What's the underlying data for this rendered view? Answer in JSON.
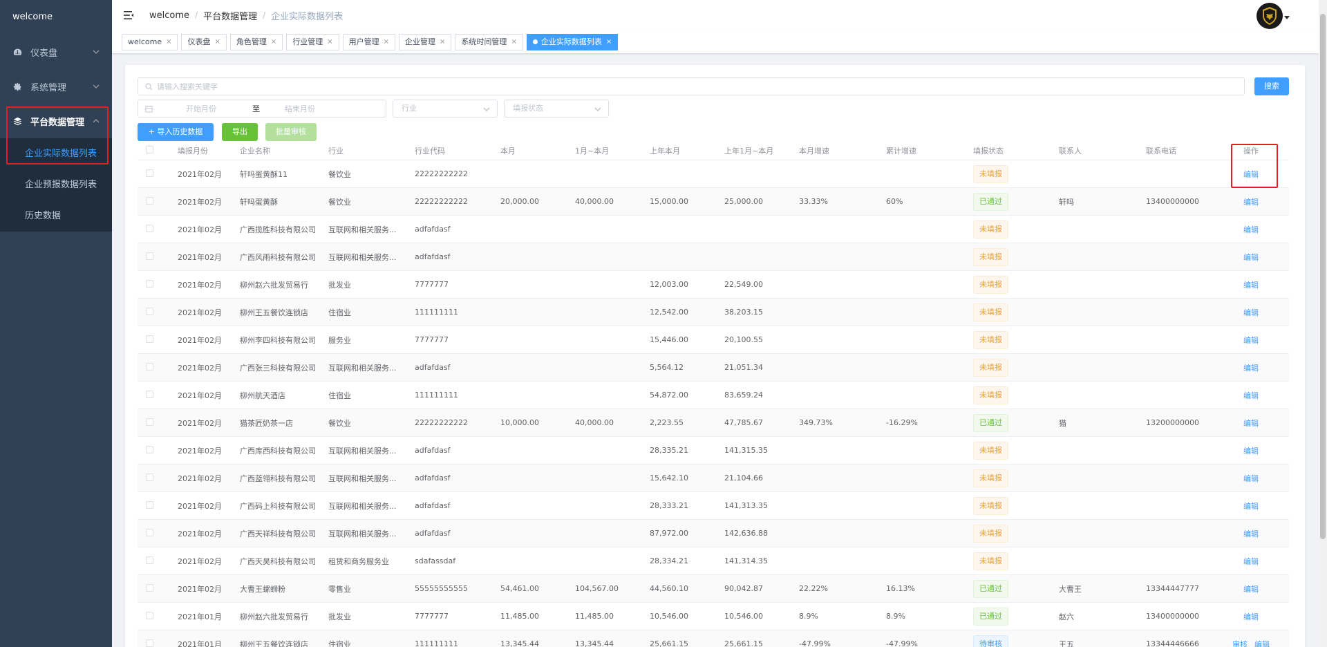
{
  "sidebar": {
    "brand": "welcome",
    "menu": [
      {
        "label": "仪表盘",
        "icon": "dashboard-icon"
      },
      {
        "label": "系统管理",
        "icon": "gear-icon"
      },
      {
        "label": "平台数据管理",
        "icon": "layers-icon"
      }
    ],
    "submenu": [
      "企业实际数据列表",
      "企业预报数据列表",
      "历史数据"
    ]
  },
  "breadcrumb": [
    "welcome",
    "平台数据管理",
    "企业实际数据列表"
  ],
  "tags": [
    "welcome",
    "仪表盘",
    "角色管理",
    "行业管理",
    "用户管理",
    "企业管理",
    "系统时间管理",
    "企业实际数据列表"
  ],
  "filters": {
    "search_placeholder": "请输入搜索关键字",
    "search_button": "搜索",
    "start_month": "开始月份",
    "range_to": "至",
    "end_month": "结束月份",
    "industry_placeholder": "行业",
    "status_placeholder": "填报状态"
  },
  "actions": {
    "import": "导入历史数据",
    "export": "导出",
    "batch": "批量审核"
  },
  "table": {
    "headers": [
      "",
      "填报月份",
      "企业名称",
      "行业",
      "行业代码",
      "本月",
      "1月~本月",
      "上年本月",
      "上年1月~本月",
      "本月增速",
      "累计增速",
      "填报状态",
      "联系人",
      "联系电话",
      "操作"
    ],
    "edit_label": "编辑",
    "review_label": "审核",
    "rows": [
      {
        "month": "2021年02月",
        "company": "轩吗蛋黄酥11",
        "industry": "餐饮业",
        "code": "22222222222",
        "cur": "",
        "ytd": "",
        "ly_cur": "",
        "ly_ytd": "",
        "growth": "",
        "cum_growth": "",
        "status": "未填报",
        "status_type": "unfilled",
        "contact": "",
        "phone": ""
      },
      {
        "month": "2021年02月",
        "company": "轩吗蛋黄酥",
        "industry": "餐饮业",
        "code": "22222222222",
        "cur": "20,000.00",
        "ytd": "40,000.00",
        "ly_cur": "15,000.00",
        "ly_ytd": "25,000.00",
        "growth": "33.33%",
        "cum_growth": "60%",
        "status": "已通过",
        "status_type": "passed",
        "contact": "轩吗",
        "phone": "13400000000"
      },
      {
        "month": "2021年02月",
        "company": "广西揽胜科技有限公司",
        "industry": "互联网和相关服务...",
        "code": "adfafdasf",
        "cur": "",
        "ytd": "",
        "ly_cur": "",
        "ly_ytd": "",
        "growth": "",
        "cum_growth": "",
        "status": "未填报",
        "status_type": "unfilled",
        "contact": "",
        "phone": ""
      },
      {
        "month": "2021年02月",
        "company": "广西风雨科技有限公司",
        "industry": "互联网和相关服务...",
        "code": "adfafdasf",
        "cur": "",
        "ytd": "",
        "ly_cur": "",
        "ly_ytd": "",
        "growth": "",
        "cum_growth": "",
        "status": "未填报",
        "status_type": "unfilled",
        "contact": "",
        "phone": ""
      },
      {
        "month": "2021年02月",
        "company": "柳州赵六批发贸易行",
        "industry": "批发业",
        "code": "7777777",
        "cur": "",
        "ytd": "",
        "ly_cur": "12,003.00",
        "ly_ytd": "22,549.00",
        "growth": "",
        "cum_growth": "",
        "status": "未填报",
        "status_type": "unfilled",
        "contact": "",
        "phone": ""
      },
      {
        "month": "2021年02月",
        "company": "柳州王五餐饮连锁店",
        "industry": "住宿业",
        "code": "111111111",
        "cur": "",
        "ytd": "",
        "ly_cur": "12,542.00",
        "ly_ytd": "38,203.15",
        "growth": "",
        "cum_growth": "",
        "status": "未填报",
        "status_type": "unfilled",
        "contact": "",
        "phone": ""
      },
      {
        "month": "2021年02月",
        "company": "柳州李四科技有限公司",
        "industry": "服务业",
        "code": "7777777",
        "cur": "",
        "ytd": "",
        "ly_cur": "15,446.00",
        "ly_ytd": "20,100.55",
        "growth": "",
        "cum_growth": "",
        "status": "未填报",
        "status_type": "unfilled",
        "contact": "",
        "phone": ""
      },
      {
        "month": "2021年02月",
        "company": "广西张三科技有限公司",
        "industry": "互联网和相关服务...",
        "code": "adfafdasf",
        "cur": "",
        "ytd": "",
        "ly_cur": "5,564.12",
        "ly_ytd": "21,051.34",
        "growth": "",
        "cum_growth": "",
        "status": "未填报",
        "status_type": "unfilled",
        "contact": "",
        "phone": ""
      },
      {
        "month": "2021年02月",
        "company": "柳州航天酒店",
        "industry": "住宿业",
        "code": "111111111",
        "cur": "",
        "ytd": "",
        "ly_cur": "54,872.00",
        "ly_ytd": "83,659.24",
        "growth": "",
        "cum_growth": "",
        "status": "未填报",
        "status_type": "unfilled",
        "contact": "",
        "phone": ""
      },
      {
        "month": "2021年02月",
        "company": "猫茶匠奶茶一店",
        "industry": "餐饮业",
        "code": "22222222222",
        "cur": "10,000.00",
        "ytd": "40,000.00",
        "ly_cur": "2,223.55",
        "ly_ytd": "47,785.67",
        "growth": "349.73%",
        "cum_growth": "-16.29%",
        "status": "已通过",
        "status_type": "passed",
        "contact": "猫",
        "phone": "13200000000"
      },
      {
        "month": "2021年02月",
        "company": "广西库西科技有限公司",
        "industry": "互联网和相关服务...",
        "code": "adfafdasf",
        "cur": "",
        "ytd": "",
        "ly_cur": "28,335.21",
        "ly_ytd": "141,315.35",
        "growth": "",
        "cum_growth": "",
        "status": "未填报",
        "status_type": "unfilled",
        "contact": "",
        "phone": ""
      },
      {
        "month": "2021年02月",
        "company": "广西蓝翎科技有限公司",
        "industry": "互联网和相关服务...",
        "code": "adfafdasf",
        "cur": "",
        "ytd": "",
        "ly_cur": "15,642.10",
        "ly_ytd": "21,104.66",
        "growth": "",
        "cum_growth": "",
        "status": "未填报",
        "status_type": "unfilled",
        "contact": "",
        "phone": ""
      },
      {
        "month": "2021年02月",
        "company": "广西码上科技有限公司",
        "industry": "互联网和相关服务...",
        "code": "adfafdasf",
        "cur": "",
        "ytd": "",
        "ly_cur": "28,333.21",
        "ly_ytd": "141,313.35",
        "growth": "",
        "cum_growth": "",
        "status": "未填报",
        "status_type": "unfilled",
        "contact": "",
        "phone": ""
      },
      {
        "month": "2021年02月",
        "company": "广西天祥科技有限公司",
        "industry": "互联网和相关服务...",
        "code": "adfafdasf",
        "cur": "",
        "ytd": "",
        "ly_cur": "87,972.00",
        "ly_ytd": "142,636.88",
        "growth": "",
        "cum_growth": "",
        "status": "未填报",
        "status_type": "unfilled",
        "contact": "",
        "phone": ""
      },
      {
        "month": "2021年02月",
        "company": "广西天昊科技有限公司",
        "industry": "租赁和商务服务业",
        "code": "sdafassdaf",
        "cur": "",
        "ytd": "",
        "ly_cur": "28,334.21",
        "ly_ytd": "141,314.35",
        "growth": "",
        "cum_growth": "",
        "status": "未填报",
        "status_type": "unfilled",
        "contact": "",
        "phone": ""
      },
      {
        "month": "2021年02月",
        "company": "大曹王螺蛳粉",
        "industry": "零售业",
        "code": "55555555555",
        "cur": "54,461.00",
        "ytd": "104,567.00",
        "ly_cur": "44,560.10",
        "ly_ytd": "90,042.87",
        "growth": "22.22%",
        "cum_growth": "16.13%",
        "status": "已通过",
        "status_type": "passed",
        "contact": "大曹王",
        "phone": "13344447777"
      },
      {
        "month": "2021年01月",
        "company": "柳州赵六批发贸易行",
        "industry": "批发业",
        "code": "7777777",
        "cur": "11,485.00",
        "ytd": "11,485.00",
        "ly_cur": "10,546.00",
        "ly_ytd": "10,546.00",
        "growth": "8.9%",
        "cum_growth": "8.9%",
        "status": "已通过",
        "status_type": "passed",
        "contact": "赵六",
        "phone": "13400000000"
      },
      {
        "month": "2021年01月",
        "company": "柳州王五餐饮连锁店",
        "industry": "住宿业",
        "code": "111111111",
        "cur": "13,345.44",
        "ytd": "13,345.44",
        "ly_cur": "25,661.15",
        "ly_ytd": "25,661.15",
        "growth": "-47.99%",
        "cum_growth": "-47.99%",
        "status": "待审核",
        "status_type": "pending",
        "contact": "王五",
        "phone": "13344446666"
      }
    ]
  }
}
